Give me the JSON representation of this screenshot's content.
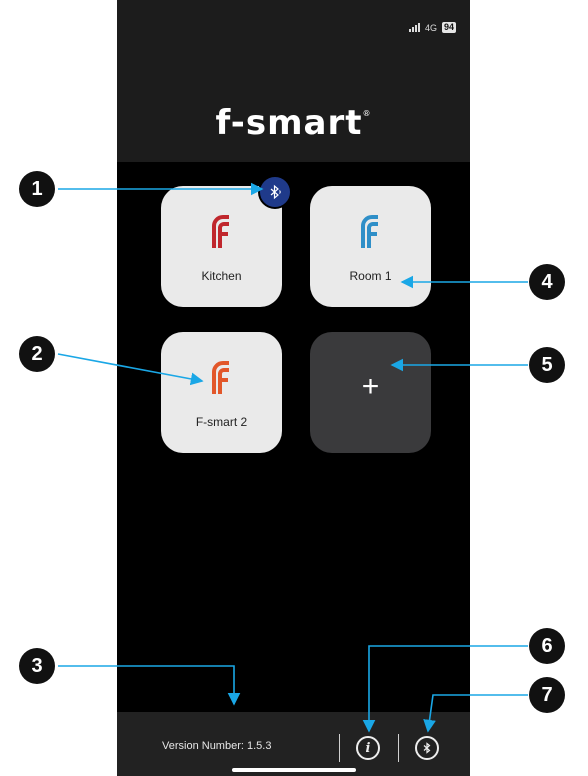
{
  "status_bar": {
    "network": "4G",
    "battery": "94"
  },
  "app": {
    "logo_text": "f-smart",
    "logo_mark": "®"
  },
  "devices": [
    {
      "label": "Kitchen",
      "icon": "f-smart-logo-red-icon",
      "color": "#c0272d"
    },
    {
      "label": "Room 1",
      "icon": "f-smart-logo-blue-icon",
      "color": "#2f8fc8"
    },
    {
      "label": "F-smart 2",
      "icon": "f-smart-logo-orange-icon",
      "color": "#e2572a"
    }
  ],
  "add_tile": {
    "symbol": "+"
  },
  "footer": {
    "version": "Version Number: 1.5.3"
  },
  "annotations": [
    "1",
    "2",
    "3",
    "4",
    "5",
    "6",
    "7"
  ],
  "colors": {
    "arrow": "#1aa7e6",
    "bluetooth_badge": "#1f3a8a",
    "background": "#000000"
  }
}
